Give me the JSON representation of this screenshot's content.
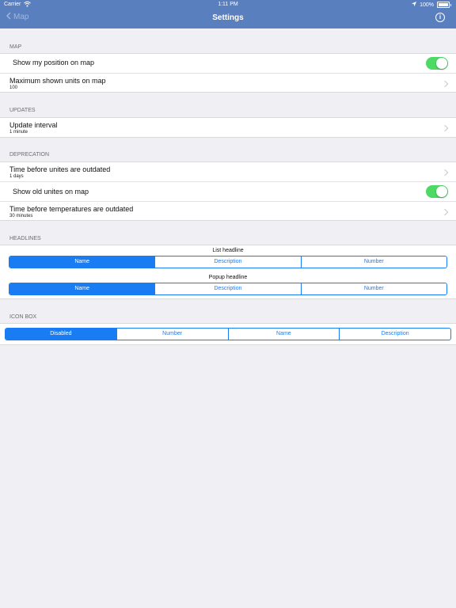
{
  "status": {
    "carrier": "Carrier",
    "time": "1:11 PM",
    "battery": "100%"
  },
  "nav": {
    "back": "Map",
    "title": "Settings",
    "info_icon": "info-icon"
  },
  "map": {
    "header": "MAP",
    "show_position": {
      "label": "Show my position on map",
      "on": true
    },
    "max_units": {
      "label": "Maximum shown units on map",
      "value": "100"
    }
  },
  "updates": {
    "header": "UPDATES",
    "interval": {
      "label": "Update interval",
      "value": "1 minute"
    }
  },
  "deprecation": {
    "header": "DEPRECATION",
    "units_outdated": {
      "label": "Time before unites are outdated",
      "value": "1 days"
    },
    "show_old": {
      "label": "Show old unites on map",
      "on": true
    },
    "temps_outdated": {
      "label": "Time before temperatures are outdated",
      "value": "30 minutes"
    }
  },
  "headlines": {
    "header": "HEADLINES",
    "list": {
      "label": "List headline",
      "options": [
        "Name",
        "Description",
        "Number"
      ],
      "selected": 0
    },
    "popup": {
      "label": "Popup headline",
      "options": [
        "Name",
        "Description",
        "Number"
      ],
      "selected": 0
    }
  },
  "iconbox": {
    "header": "ICON BOX",
    "options": [
      "Disabled",
      "Number",
      "Name",
      "Description"
    ],
    "selected": 0
  },
  "colors": {
    "nav_bg": "#5a7fbf",
    "accent": "#1a7cf2",
    "toggle_on": "#4cd964"
  }
}
